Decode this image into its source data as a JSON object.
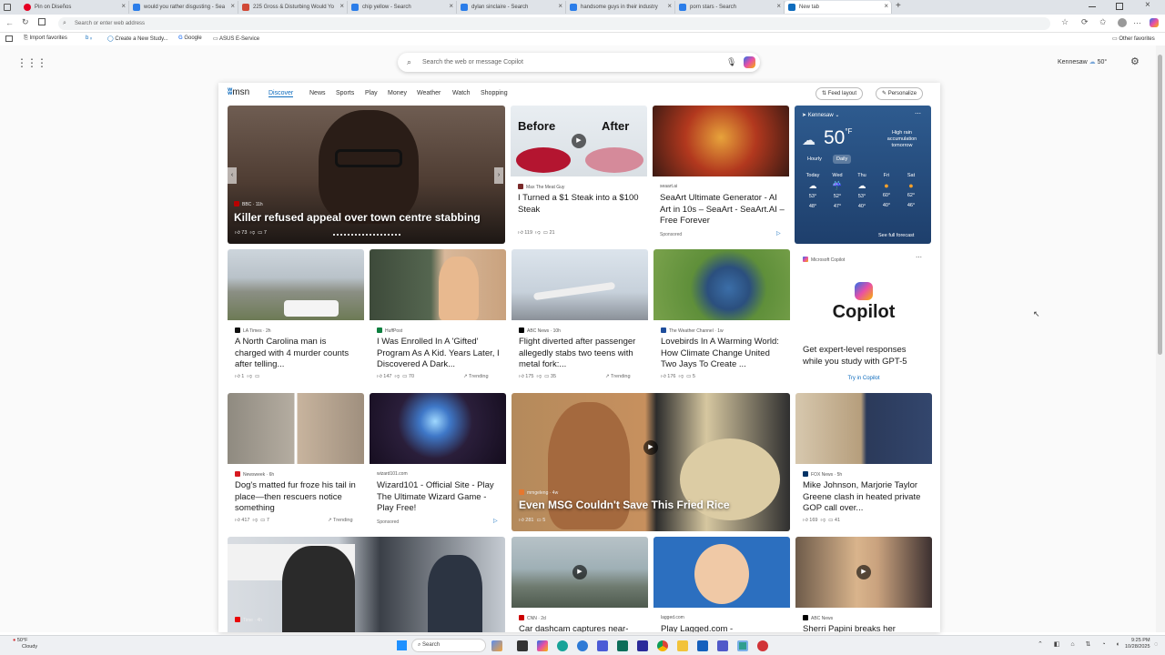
{
  "tabs": [
    {
      "label": "Pin on Diseños",
      "color": "#e60023"
    },
    {
      "label": "would you rather disgusting - Sea",
      "color": "#2b7de9"
    },
    {
      "label": "225 Gross & Disturbing Would Yo",
      "color": "#d14836"
    },
    {
      "label": "chip yellow - Search",
      "color": "#2b7de9"
    },
    {
      "label": "dylan sinclaire - Search",
      "color": "#2b7de9"
    },
    {
      "label": "handsome guys in their industry",
      "color": "#2b7de9"
    },
    {
      "label": "porn stars - Search",
      "color": "#2b7de9"
    },
    {
      "label": "New tab",
      "color": "#0f6cbd"
    }
  ],
  "address": {
    "placeholder": "Search or enter web address"
  },
  "favorites": {
    "import": "Import favorites",
    "create": "Create a New Study...",
    "google": "Google",
    "asus": "ASUS E-Service",
    "other": "Other favorites"
  },
  "search": {
    "placeholder": "Search the web or message Copilot"
  },
  "location": {
    "city": "Kennesaw",
    "temp": "50°"
  },
  "msn": {
    "logo": "msn",
    "nav": [
      "Discover",
      "News",
      "Sports",
      "Play",
      "Money",
      "Weather",
      "Watch",
      "Shopping"
    ],
    "feed_layout": "Feed layout",
    "personalize": "Personalize"
  },
  "hero": {
    "source": "BBC · 11h",
    "title": "Killer refused appeal over town centre stabbing",
    "likes": "73",
    "comments": "7"
  },
  "steak": {
    "before": "Before",
    "after": "After",
    "source": "Max The Meat Guy",
    "title": "I Turned a $1 Steak into a $100 Steak",
    "likes": "119",
    "comments": "21"
  },
  "seaart": {
    "source": "seaart.ai",
    "title": "SeaArt Ultimate Generator - AI Art in 10s – SeaArt - SeaArt.AI – Free Forever",
    "sponsored": "Sponsored"
  },
  "weather": {
    "city": "Kennesaw",
    "temp": "50",
    "unit": "°F",
    "alert": "High rain accumulation tomorrow",
    "hourly": "Hourly",
    "daily": "Daily",
    "days": [
      {
        "d": "Today",
        "hi": "53°",
        "lo": "48°"
      },
      {
        "d": "Wed",
        "hi": "52°",
        "lo": "47°"
      },
      {
        "d": "Thu",
        "hi": "53°",
        "lo": "40°"
      },
      {
        "d": "Fri",
        "hi": "60°",
        "lo": "40°"
      },
      {
        "d": "Sat",
        "hi": "62°",
        "lo": "46°"
      }
    ],
    "forecast": "See full forecast"
  },
  "row2": [
    {
      "source": "LA Times · 2h",
      "title": "A North Carolina man is charged with 4 murder counts after telling...",
      "likes": "1",
      "comments": "",
      "trend": ""
    },
    {
      "source": "HuffPost",
      "title": "I Was Enrolled In A 'Gifted' Program As A Kid. Years Later, I Discovered A Dark...",
      "likes": "147",
      "comments": "70",
      "trend": "Trending"
    },
    {
      "source": "ABC News · 10h",
      "title": "Flight diverted after passenger allegedly stabs two teens with metal fork:...",
      "likes": "175",
      "comments": "35",
      "trend": "Trending"
    },
    {
      "source": "The Weather Channel · 1w",
      "title": "Lovebirds In A Warming World: How Climate Change United Two Jays To Create ...",
      "likes": "176",
      "comments": "5",
      "trend": ""
    }
  ],
  "copilot": {
    "source": "Microsoft Copilot",
    "name": "Copilot",
    "title": "Get expert-level responses while you study with GPT-5",
    "cta": "Try in Copilot"
  },
  "row3": {
    "dog": {
      "source": "Newsweek · 6h",
      "title": "Dog's matted fur froze his tail in place—then rescuers notice something",
      "likes": "417",
      "comments": "7",
      "trend": "Trending"
    },
    "wizard": {
      "source": "wizard101.com",
      "title": "Wizard101 - Official Site - Play The Ultimate Wizard Game - Play Free!",
      "sponsored": "Sponsored"
    },
    "rice": {
      "source": "mmgeleng · 4w",
      "title": "Even MSG Couldn't Save This Fried Rice",
      "likes": "281",
      "comments": "5"
    },
    "gop": {
      "source": "FOX News · 5h",
      "title": "Mike Johnson, Marjorie Taylor Greene clash in heated private GOP call over...",
      "likes": "169",
      "comments": "41"
    }
  },
  "row4": {
    "court": {
      "source": "Time · 4h"
    },
    "dashcam": {
      "source": "CNN · 2d",
      "title": "Car dashcam captures near-"
    },
    "lagged": {
      "source": "lagged.com",
      "title": "Play Lagged.com -"
    },
    "panini": {
      "source": "ABC News",
      "title": "Sherri Papini breaks her"
    }
  },
  "taskbar": {
    "weather_temp": "50°F",
    "weather_desc": "Cloudy",
    "search": "Search",
    "time": "9:25 PM",
    "date": "10/28/2025"
  }
}
